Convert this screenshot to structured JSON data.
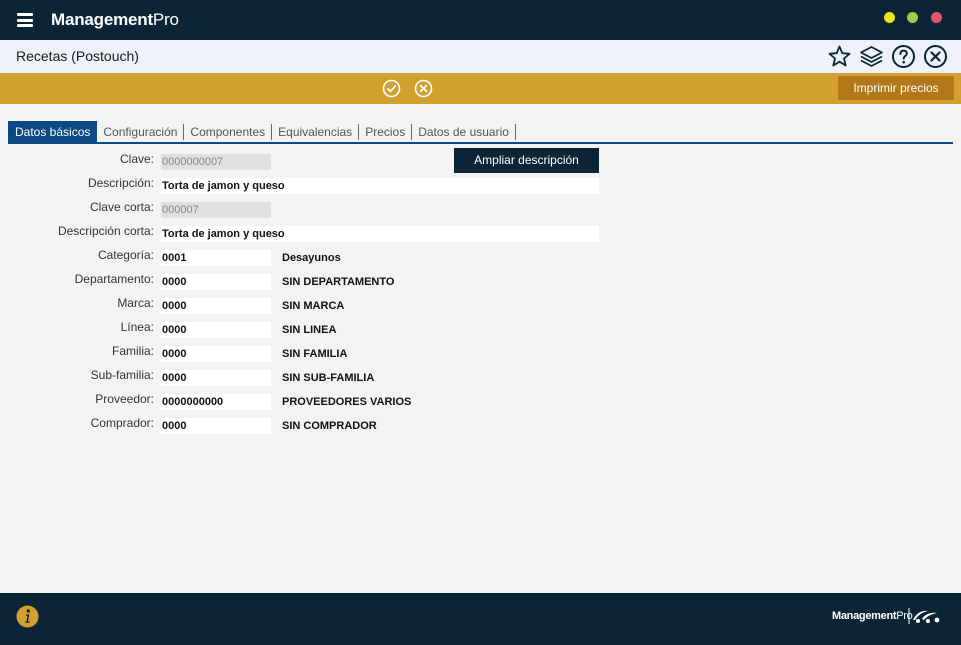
{
  "app": {
    "brand_bold": "Management",
    "brand_light": "Pro"
  },
  "header": {
    "title": "Recetas (Postouch)"
  },
  "actionbar": {
    "print_label": "Imprimir precios"
  },
  "tabs": [
    {
      "label": "Datos básicos"
    },
    {
      "label": "Configuración"
    },
    {
      "label": "Componentes"
    },
    {
      "label": "Equivalencias"
    },
    {
      "label": "Precios"
    },
    {
      "label": "Datos de usuario"
    }
  ],
  "form": {
    "ampliar_label": "Ampliar descripción",
    "clave": {
      "label": "Clave:",
      "value": "0000000007"
    },
    "descripcion": {
      "label": "Descripción:",
      "value": "Torta de jamon y queso"
    },
    "clave_corta": {
      "label": "Clave corta:",
      "value": "000007"
    },
    "descripcion_corta": {
      "label": "Descripción corta:",
      "value": "Torta de jamon y queso"
    },
    "categoria": {
      "label": "Categoría:",
      "code": "0001",
      "name": "Desayunos"
    },
    "departamento": {
      "label": "Departamento:",
      "code": "0000",
      "name": "SIN DEPARTAMENTO"
    },
    "marca": {
      "label": "Marca:",
      "code": "0000",
      "name": "SIN MARCA"
    },
    "linea": {
      "label": "Línea:",
      "code": "0000",
      "name": "SIN LINEA"
    },
    "familia": {
      "label": "Familia:",
      "code": "0000",
      "name": "SIN FAMILIA"
    },
    "subfamilia": {
      "label": "Sub-familia:",
      "code": "0000",
      "name": "SIN SUB-FAMILIA"
    },
    "proveedor": {
      "label": "Proveedor:",
      "code": "0000000000",
      "name": "PROVEEDORES VARIOS"
    },
    "comprador": {
      "label": "Comprador:",
      "code": "0000",
      "name": "SIN COMPRADOR"
    }
  },
  "footer": {
    "brand_bold": "Management",
    "brand_light": "Pro"
  },
  "icons": {
    "menu": "hamburger-icon",
    "favorite": "star-icon",
    "layers": "layers-icon",
    "help": "help-icon",
    "close": "close-icon",
    "accept": "check-circle-icon",
    "cancel": "x-circle-icon",
    "info": "info-icon"
  },
  "colors": {
    "titlebar": "#0c2536",
    "actionbar": "#d1a02f",
    "print_button": "#b37819",
    "tab_active": "#0d4a83"
  }
}
